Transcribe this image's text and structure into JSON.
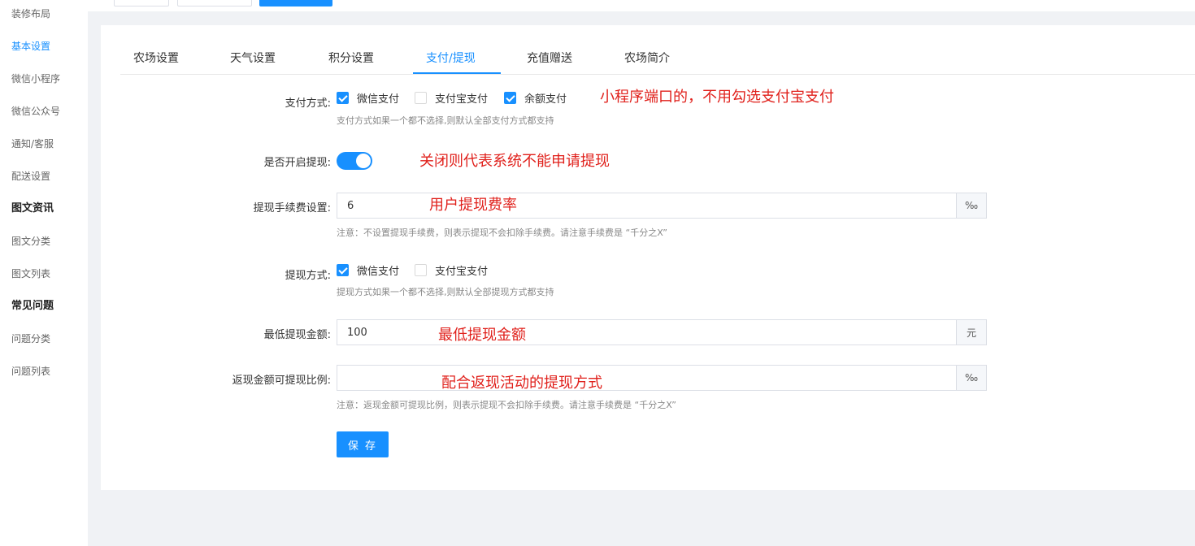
{
  "sidebar": {
    "items": [
      {
        "label": "装修布局"
      },
      {
        "label": "基本设置"
      },
      {
        "label": "微信小程序"
      },
      {
        "label": "微信公众号"
      },
      {
        "label": "通知/客服"
      },
      {
        "label": "配送设置"
      },
      {
        "label": "图文资讯"
      },
      {
        "label": "图文分类"
      },
      {
        "label": "图文列表"
      },
      {
        "label": "常见问题"
      },
      {
        "label": "问题分类"
      },
      {
        "label": "问题列表"
      }
    ]
  },
  "tabs": [
    {
      "label": "农场设置"
    },
    {
      "label": "天气设置"
    },
    {
      "label": "积分设置"
    },
    {
      "label": "支付/提现"
    },
    {
      "label": "充值赠送"
    },
    {
      "label": "农场简介"
    }
  ],
  "form": {
    "payment": {
      "label": "支付方式:",
      "options": [
        {
          "label": "微信支付",
          "checked": true
        },
        {
          "label": "支付宝支付",
          "checked": false
        },
        {
          "label": "余额支付",
          "checked": true
        }
      ],
      "hint": "支付方式如果一个都不选择,则默认全部支付方式都支持"
    },
    "withdraw_enabled": {
      "label": "是否开启提现:",
      "on": true
    },
    "fee": {
      "label": "提现手续费设置:",
      "value": "6",
      "unit": "‰",
      "hint": "注意：不设置提现手续费，则表示提现不会扣除手续费。请注意手续费是 “千分之X”"
    },
    "withdraw_method": {
      "label": "提现方式:",
      "options": [
        {
          "label": "微信支付",
          "checked": true
        },
        {
          "label": "支付宝支付",
          "checked": false
        }
      ],
      "hint": "提现方式如果一个都不选择,则默认全部提现方式都支持"
    },
    "min_amount": {
      "label": "最低提现金额:",
      "value": "100",
      "unit": "元"
    },
    "cashback_ratio": {
      "label": "返现金额可提现比例:",
      "value": "",
      "unit": "‰",
      "hint": "注意：返现金额可提现比例，则表示提现不会扣除手续费。请注意手续费是 “千分之X”"
    },
    "save_label": "保 存"
  },
  "annotations": {
    "payment": "小程序端口的，不用勾选支付宝支付",
    "withdraw": "关闭则代表系统不能申请提现",
    "fee": "用户提现费率",
    "min_amount": "最低提现金额",
    "cashback": "配合返现活动的提现方式"
  },
  "colors": {
    "accent": "#1890ff",
    "annotation": "#e0201b"
  }
}
